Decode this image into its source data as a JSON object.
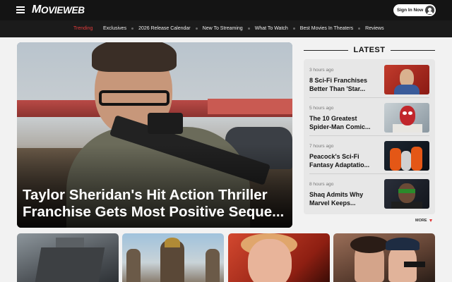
{
  "header": {
    "logo_m": "M",
    "logo_rest": "OVIEWEB",
    "signin_label": "Sign In Now"
  },
  "nav": {
    "trending_label": "Trending",
    "items": [
      "Exclusives",
      "2026 Release Calendar",
      "New To Streaming",
      "What To Watch",
      "Best Movies In Theaters",
      "Reviews"
    ]
  },
  "hero": {
    "title": "Taylor Sheridan's Hit Action Thriller Franchise Gets Most Positive Seque..."
  },
  "latest": {
    "heading": "LATEST",
    "items": [
      {
        "time": "3 hours ago",
        "title": "8 Sci-Fi Franchises Better Than 'Star..."
      },
      {
        "time": "5 hours ago",
        "title": "The 10 Greatest Spider-Man Comic..."
      },
      {
        "time": "7 hours ago",
        "title": "Peacock's Sci-Fi Fantasy Adaptatio..."
      },
      {
        "time": "8 hours ago",
        "title": "Shaq Admits Why Marvel Keeps..."
      }
    ],
    "more_label": "MORE"
  },
  "colors": {
    "header_bg": "#141414",
    "nav_bg": "#1b1b1b",
    "trending": "#e33b3b",
    "page_bg": "#f2f2f2"
  }
}
